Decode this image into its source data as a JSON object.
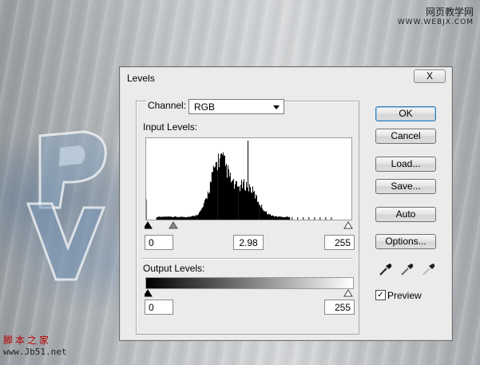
{
  "watermarks": {
    "top_line1": "网页教学网",
    "top_line2": "WWW.WEBJX.COM",
    "bottom_line1": "脚本之家",
    "bottom_line2": "www.Jb51.net"
  },
  "dialog": {
    "title": "Levels",
    "close_label": "X",
    "channel_label": "Channel:",
    "channel_value": "RGB",
    "input_levels_label": "Input Levels:",
    "input_black": "0",
    "input_gamma": "2.98",
    "input_white": "255",
    "output_levels_label": "Output Levels:",
    "output_black": "0",
    "output_white": "255",
    "buttons": {
      "ok": "OK",
      "cancel": "Cancel",
      "load": "Load...",
      "save": "Save...",
      "auto": "Auto",
      "options": "Options..."
    },
    "preview_label": "Preview",
    "preview_checked": true,
    "eyedroppers": [
      "black-eyedropper-icon",
      "gray-eyedropper-icon",
      "white-eyedropper-icon"
    ]
  },
  "colors": {
    "dialog_bg": "#ebebeb",
    "default_button_border": "#3c7fb1"
  }
}
